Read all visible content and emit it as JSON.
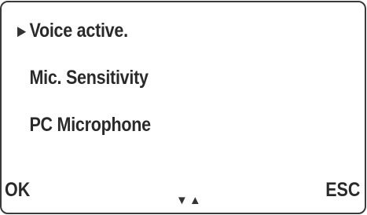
{
  "menu": {
    "items": [
      {
        "label": "Voice active.",
        "selected": true
      },
      {
        "label": "Mic. Sensitivity",
        "selected": false
      },
      {
        "label": "PC Microphone",
        "selected": false
      }
    ]
  },
  "softkeys": {
    "left_label": "OK",
    "right_label": "ESC"
  },
  "navigation": {
    "down_icon": "triangle-down-icon",
    "up_icon": "triangle-up-icon"
  },
  "colors": {
    "text": "#2a2a2a",
    "border": "#3a3a3a",
    "background": "#ffffff"
  }
}
